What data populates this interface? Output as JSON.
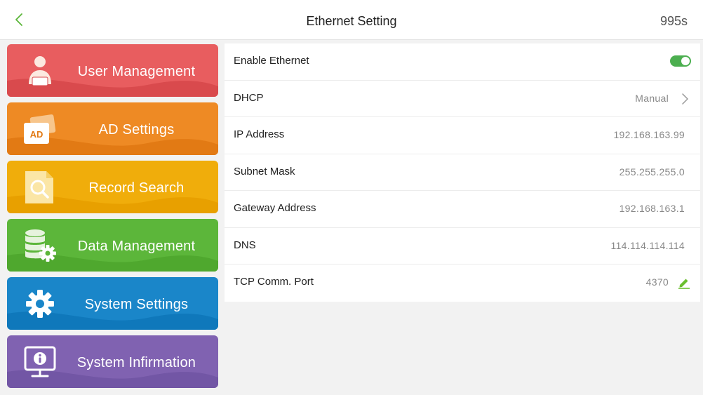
{
  "header": {
    "title": "Ethernet Setting",
    "countdown": "995s",
    "back_icon": "chevron-left-icon"
  },
  "menu": [
    {
      "label": "User Management",
      "icon": "user-icon",
      "color": "#e85d5f"
    },
    {
      "label": "AD Settings",
      "icon": "ad-card-icon",
      "badge": "AD",
      "color": "#ee8a24"
    },
    {
      "label": "Record Search",
      "icon": "search-document-icon",
      "color": "#f0ad0b"
    },
    {
      "label": "Data Management",
      "icon": "database-gear-icon",
      "color": "#5cb63a"
    },
    {
      "label": "System Settings",
      "icon": "gear-icon",
      "color": "#1a86c9"
    },
    {
      "label": "System Infirmation",
      "icon": "info-monitor-icon",
      "color": "#8062b1"
    }
  ],
  "settings": {
    "enable_ethernet": {
      "label": "Enable Ethernet",
      "enabled": true,
      "accent": "#4caf50"
    },
    "dhcp": {
      "label": "DHCP",
      "value": "Manual"
    },
    "ip_address": {
      "label": "IP Address",
      "value": "192.168.163.99"
    },
    "subnet_mask": {
      "label": "Subnet Mask",
      "value": "255.255.255.0"
    },
    "gateway_address": {
      "label": "Gateway Address",
      "value": "192.168.163.1"
    },
    "dns": {
      "label": "DNS",
      "value": "114.114.114.114"
    },
    "tcp_port": {
      "label": "TCP Comm. Port",
      "value": "4370"
    }
  }
}
